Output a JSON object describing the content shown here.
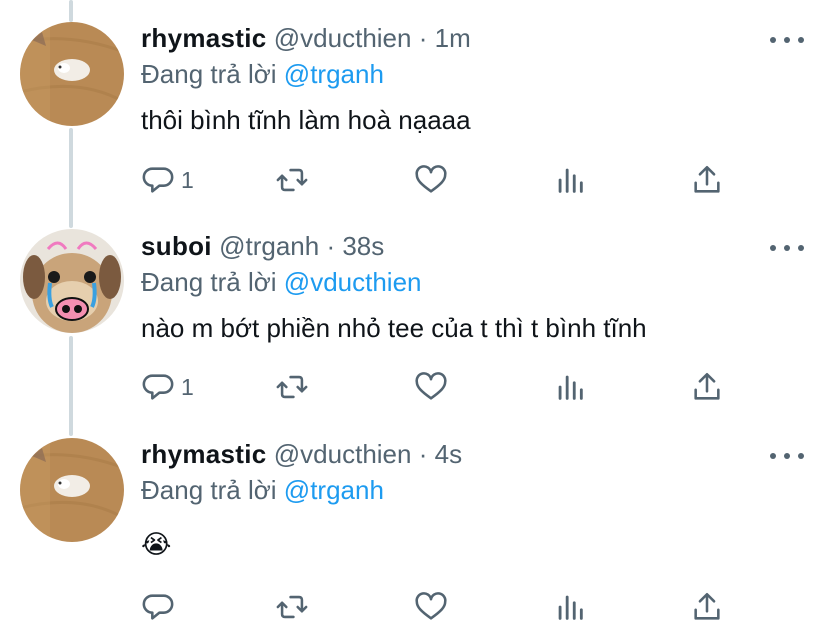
{
  "tweets": [
    {
      "display_name": "rhymastic",
      "handle": "@vducthien",
      "separator": "·",
      "time": "1m",
      "replying_prefix": "Đang trả lời",
      "replying_to": "@trganh",
      "text": "thôi bình tĩnh làm hoà nạaaa",
      "reply_count": "1",
      "avatar": "hamster-on-wood-avatar"
    },
    {
      "display_name": "suboi",
      "handle": "@trganh",
      "separator": "·",
      "time": "38s",
      "replying_prefix": "Đang trả lời",
      "replying_to": "@vducthien",
      "text": "nào m bớt phiền nhỏ tee của t thì t bình tĩnh",
      "reply_count": "1",
      "avatar": "crying-puppy-avatar"
    },
    {
      "display_name": "rhymastic",
      "handle": "@vducthien",
      "separator": "·",
      "time": "4s",
      "replying_prefix": "Đang trả lời",
      "replying_to": "@trganh",
      "text": "😭",
      "reply_count": "",
      "avatar": "hamster-on-wood-avatar"
    }
  ],
  "icons": [
    "more-icon",
    "reply-icon",
    "retweet-icon",
    "like-icon",
    "analytics-icon",
    "share-icon"
  ],
  "colors": {
    "mention": "#1d9bf0",
    "secondary_text": "#536471",
    "primary_text": "#0f1419",
    "thread_line": "#cfd9de"
  }
}
